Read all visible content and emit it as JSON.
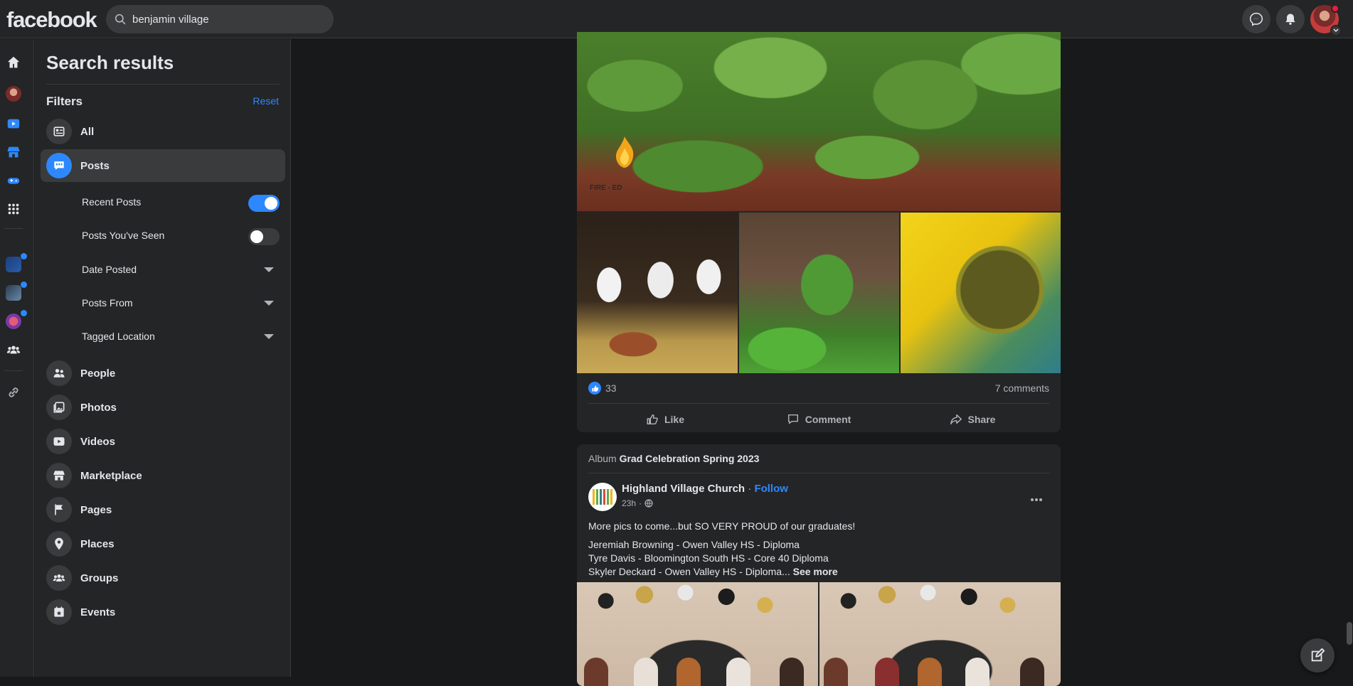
{
  "app": {
    "logo": "facebook"
  },
  "search": {
    "value": "benjamin village"
  },
  "sidebar": {
    "title": "Search results",
    "filters_label": "Filters",
    "reset_label": "Reset",
    "categories": [
      {
        "label": "All",
        "icon": "feed-icon"
      },
      {
        "label": "Posts",
        "icon": "posts-icon",
        "active": true
      },
      {
        "label": "People",
        "icon": "people-icon"
      },
      {
        "label": "Photos",
        "icon": "photos-icon"
      },
      {
        "label": "Videos",
        "icon": "videos-icon"
      },
      {
        "label": "Marketplace",
        "icon": "marketplace-icon"
      },
      {
        "label": "Pages",
        "icon": "flag-icon"
      },
      {
        "label": "Places",
        "icon": "pin-icon"
      },
      {
        "label": "Groups",
        "icon": "groups-icon"
      },
      {
        "label": "Events",
        "icon": "calendar-icon"
      }
    ],
    "post_filters": [
      {
        "label": "Recent Posts",
        "toggle": true
      },
      {
        "label": "Posts You've Seen",
        "toggle": false
      },
      {
        "label": "Date Posted"
      },
      {
        "label": "Posts From"
      },
      {
        "label": "Tagged Location"
      }
    ]
  },
  "post1": {
    "image_watermark": "FIRE - ED",
    "like_count": "33",
    "comments": "7 comments",
    "actions": {
      "like": "Like",
      "comment": "Comment",
      "share": "Share"
    }
  },
  "post2": {
    "album_prefix": "Album",
    "album_name": "Grad Celebration Spring 2023",
    "author": "Highland Village Church",
    "separator": "·",
    "follow": "Follow",
    "time": "23h",
    "text_lead": "More pics to come...but SO VERY PROUD of our graduates!",
    "lines": [
      "Jeremiah Browning - Owen Valley HS - Diploma",
      "Tyre Davis - Bloomington South HS - Core 40 Diploma",
      "Skyler Deckard - Owen Valley HS - Diploma..."
    ],
    "see_more": "See more"
  },
  "colors": {
    "accent": "#2d88ff",
    "surface": "#242526",
    "background": "#18191a",
    "notification": "#e41e3f"
  }
}
